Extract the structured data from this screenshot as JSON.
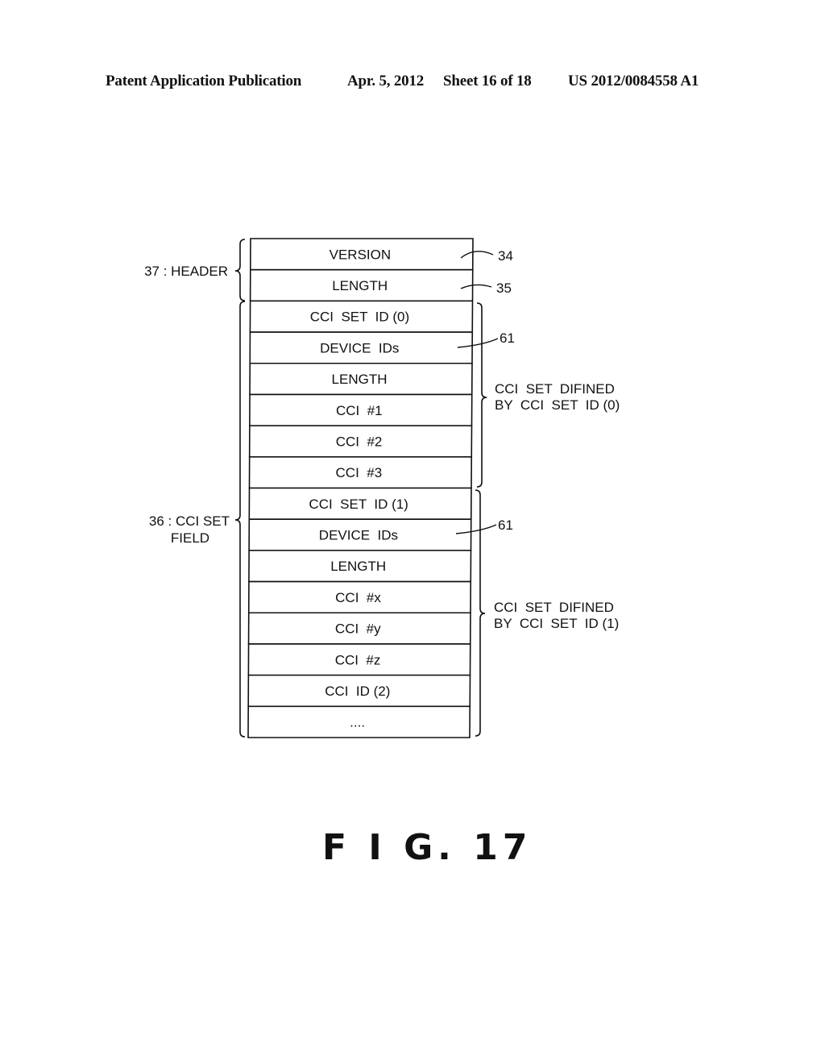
{
  "header": {
    "publication": "Patent Application Publication",
    "date": "Apr. 5, 2012",
    "sheet": "Sheet 16 of 18",
    "patent_number": "US 2012/0084558 A1"
  },
  "diagram": {
    "rows": [
      "VERSION",
      "LENGTH",
      "CCI  SET  ID (0)",
      "DEVICE  IDs",
      "LENGTH",
      "CCI  #1",
      "CCI  #2",
      "CCI  #3",
      "CCI  SET  ID (1)",
      "DEVICE  IDs",
      "LENGTH",
      "CCI  #x",
      "CCI  #y",
      "CCI  #z",
      "CCI  ID (2)",
      "...."
    ],
    "refs": {
      "version": "34",
      "length": "35",
      "device_ids_0": "61",
      "device_ids_1": "61"
    },
    "left_labels": {
      "header": "37 : HEADER",
      "cci_set_field_line1": "36 : CCI  SET",
      "cci_set_field_line2": "FIELD"
    },
    "right_labels": {
      "set0_line1": "CCI  SET  DIFINED",
      "set0_line2": "BY  CCI  SET  ID (0)",
      "set1_line1": "CCI  SET  DIFINED",
      "set1_line2": "BY  CCI  SET  ID (1)"
    }
  },
  "figure": {
    "title": "F I G. 17"
  }
}
